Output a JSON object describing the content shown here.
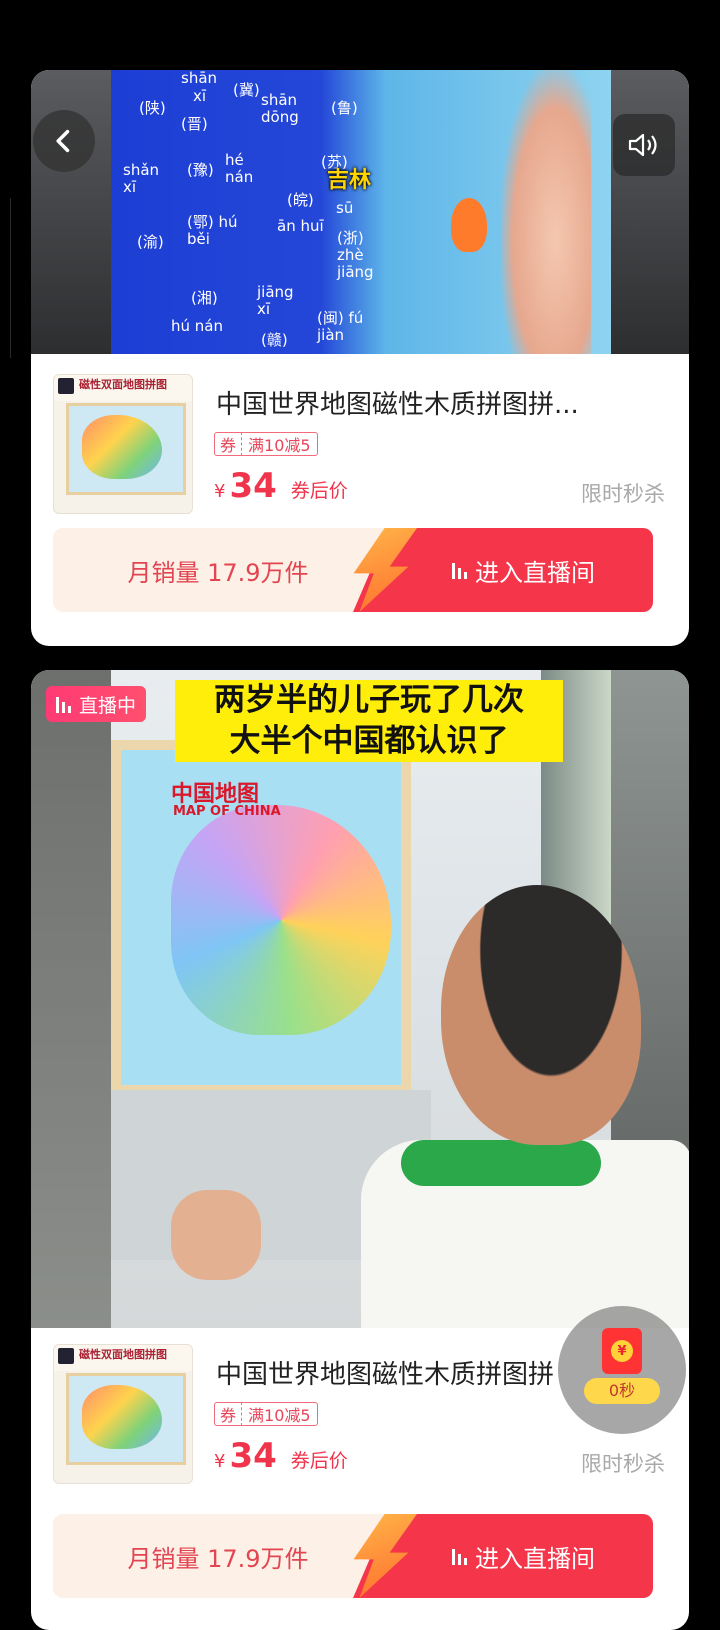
{
  "cards": [
    {
      "video_caption": "",
      "map_label": "吉林",
      "pinyin": [
        {
          "t": "shān"
        },
        {
          "t": "(冀)"
        },
        {
          "t": "(陕)"
        },
        {
          "t": "xī"
        },
        {
          "t": "shān dōng"
        },
        {
          "t": "(鲁)"
        },
        {
          "t": "(晋)"
        },
        {
          "t": "shǎn xī"
        },
        {
          "t": "(豫)"
        },
        {
          "t": "hé nán"
        },
        {
          "t": "(皖)"
        },
        {
          "t": "(苏)"
        },
        {
          "t": "sū"
        },
        {
          "t": "(渝)"
        },
        {
          "t": "(鄂) hú běi"
        },
        {
          "t": "ān huī"
        },
        {
          "t": "(浙) zhè jiāng"
        },
        {
          "t": "(湘)"
        },
        {
          "t": "hú nán"
        },
        {
          "t": "jiāng xī"
        },
        {
          "t": "(闽) fú jiàn"
        },
        {
          "t": "(赣)"
        }
      ],
      "product": {
        "thumb_header": "磁性双面地图拼图",
        "title": "中国世界地图磁性木质拼图拼...",
        "coupon_tag": "券",
        "coupon_desc": "满10减5",
        "currency": "¥",
        "price": "34",
        "price_note": "券后价",
        "flash_label": "限时秒杀"
      },
      "sales_text": "月销量 17.9万件",
      "live_button": "进入直播间"
    },
    {
      "live_badge": "直播中",
      "caption_line1": "两岁半的儿子玩了几次",
      "caption_line2": "大半个中国都认识了",
      "map_title": "中国地图",
      "map_subtitle": "MAP OF CHINA",
      "product": {
        "thumb_header": "磁性双面地图拼图",
        "title": "中国世界地图磁性木质拼图拼",
        "coupon_tag": "券",
        "coupon_desc": "满10减5",
        "currency": "¥",
        "price": "34",
        "price_note": "券后价",
        "flash_label": "限时秒杀"
      },
      "sales_text": "月销量 17.9万件",
      "live_button": "进入直播间"
    }
  ],
  "red_envelope": {
    "coin_symbol": "¥",
    "timer": "0秒"
  },
  "icons": {
    "back": "chevron-left-icon",
    "sound": "speaker-icon",
    "live": "live-bars-icon"
  },
  "colors": {
    "accent": "#f5354a",
    "price": "#f0344c",
    "coupon": "#e7465a",
    "caption_bg": "#ffee0a"
  }
}
